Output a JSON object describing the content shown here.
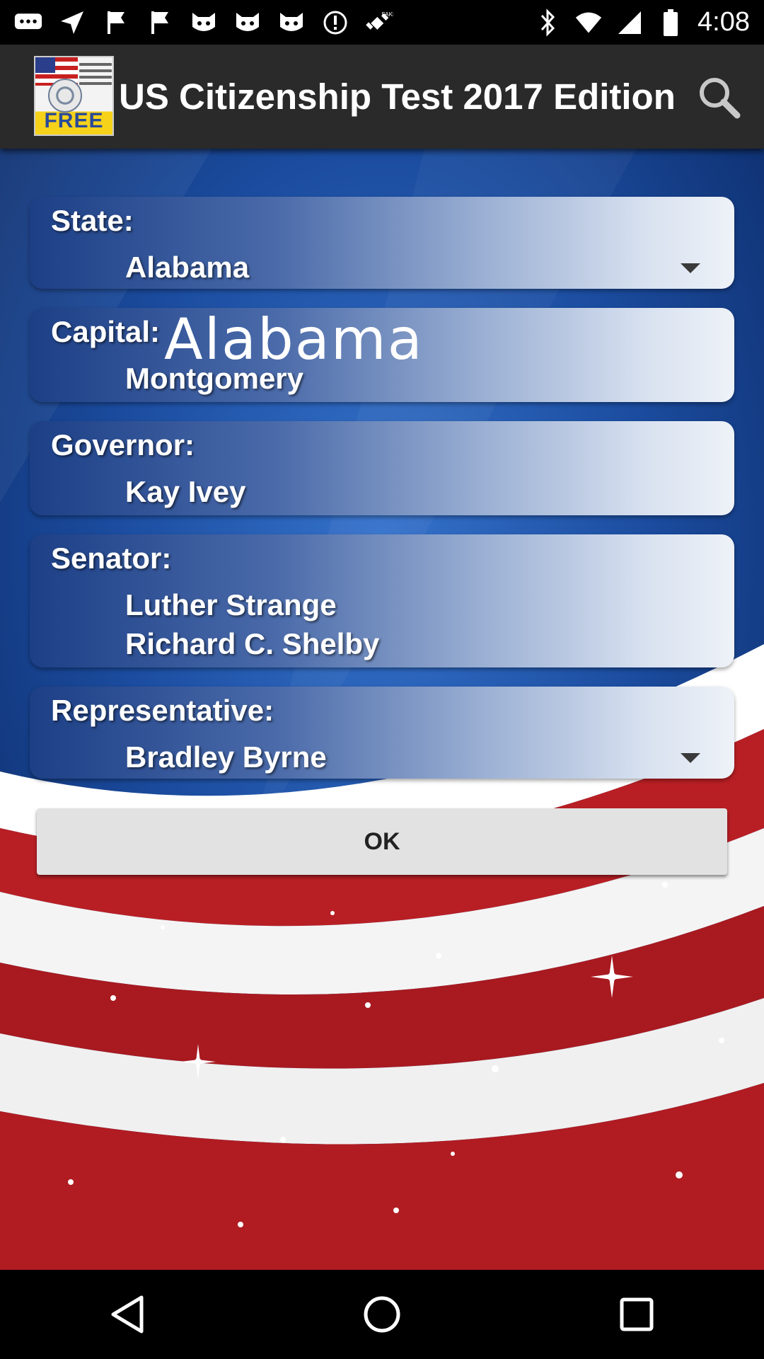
{
  "status_bar": {
    "time": "4:08",
    "icons": [
      "message-icon",
      "navigation-icon",
      "flag-icon",
      "flag-icon",
      "cat-icon",
      "cat-icon",
      "cat-icon",
      "alert-icon",
      "fake-gps-icon",
      "bluetooth-icon",
      "wifi-icon",
      "signal-icon",
      "battery-icon"
    ]
  },
  "app_bar": {
    "logo_text": "FREE",
    "title": "US Citizenship Test 2017 Edition",
    "search_icon": "search-icon"
  },
  "form": {
    "state": {
      "label": "State:",
      "value": "Alabama"
    },
    "capital": {
      "label": "Capital:",
      "overlay": "Alabama",
      "value": "Montgomery"
    },
    "governor": {
      "label": "Governor:",
      "value": "Kay Ivey"
    },
    "senator": {
      "label": "Senator:",
      "values": [
        "Luther Strange",
        "Richard C. Shelby"
      ]
    },
    "representative": {
      "label": "Representative:",
      "value": "Bradley Byrne"
    }
  },
  "ok_button": {
    "label": "OK"
  },
  "nav_bar": {
    "icons": [
      "back-icon",
      "home-icon",
      "recents-icon"
    ]
  },
  "colors": {
    "app_bar": "#2a2a2a",
    "background_blue": "#1d4fa3",
    "stripe_red": "#b81f24",
    "stripe_white": "#ffffff",
    "button": "#e2e2e2"
  }
}
